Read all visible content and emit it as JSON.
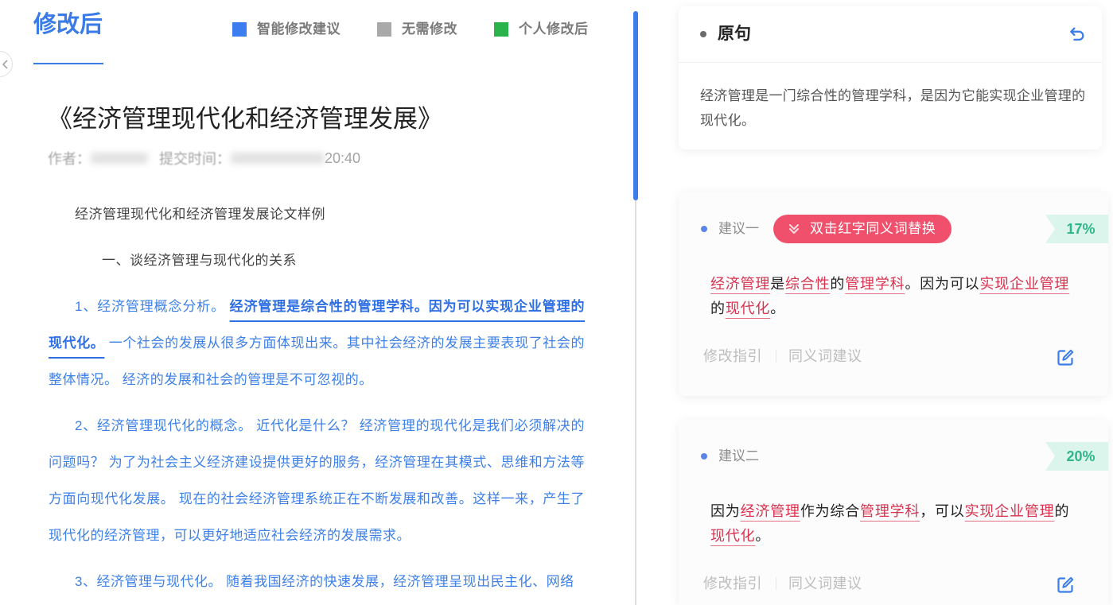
{
  "left_panel": {
    "tab_title": "修改后",
    "legend": [
      {
        "label": "智能修改建议",
        "color": "#3c7ef0"
      },
      {
        "label": "无需修改",
        "color": "#a9a9a9"
      },
      {
        "label": "个人修改后",
        "color": "#2bb34b"
      }
    ],
    "collapse_icon": "chevron-left-icon",
    "article": {
      "title": "《经济管理现代化和经济管理发展》",
      "meta": {
        "author_label": "作者：",
        "time_label": "提交时间：",
        "time_tail": "20:40"
      },
      "intro": "经济管理现代化和经济管理发展论文样例",
      "section_heading": "一、谈经济管理与现代化的关系",
      "paragraph_1": {
        "prefix": "1、经济管理概念分析。 ",
        "highlight": "经济管理是综合性的管理学科。因为可以实现企业管理的现代化。",
        "suffix": " 一个社会的发展从很多方面体现出来。其中社会经济的发展主要表现了社会的整体情况。 经济的发展和社会的管理是不可忽视的。"
      },
      "paragraph_2": "2、经济管理现代化的概念。 近代化是什么？ 经济管理的现代化是我们必须解决的问题吗？ 为了为社会主义经济建设提供更好的服务，经济管理在其模式、思维和方法等方面向现代化发展。 现在的社会经济管理系统正在不断发展和改善。这样一来，产生了现代化的经济管理，可以更好地适应社会经济的发展需求。",
      "paragraph_3": "3、经济管理与现代化。 随着我国经济的快速发展，经济管理呈现出民主化、网络"
    }
  },
  "right_panel": {
    "original": {
      "heading": "原句",
      "text": "经济管理是一门综合性的管理学科，是因为它能实现企业管理的现代化。",
      "action_icon": "undo-icon"
    },
    "suggestions": [
      {
        "label": "建议一",
        "hint_badge": "双击红字同义词替换",
        "hint_icon": "double-chevron-down-icon",
        "score": "17%",
        "body": [
          {
            "text": "经济管理",
            "synonym": true
          },
          {
            "text": "是",
            "synonym": false
          },
          {
            "text": "综合性",
            "synonym": true
          },
          {
            "text": "的",
            "synonym": false
          },
          {
            "text": "管理学科",
            "synonym": true
          },
          {
            "text": "。因为可以",
            "synonym": false
          },
          {
            "text": "实现企业管理",
            "synonym": true
          },
          {
            "text": "的",
            "synonym": false
          },
          {
            "text": "现代化",
            "synonym": true
          },
          {
            "text": "。",
            "synonym": false
          }
        ],
        "links": [
          "修改指引",
          "同义词建议"
        ],
        "edit_icon": "edit-icon"
      },
      {
        "label": "建议二",
        "score": "20%",
        "body": [
          {
            "text": "因为",
            "synonym": false
          },
          {
            "text": "经济管理",
            "synonym": true
          },
          {
            "text": "作为综合",
            "synonym": false
          },
          {
            "text": "管理学科",
            "synonym": true
          },
          {
            "text": "，可以",
            "synonym": false
          },
          {
            "text": "实现企业管理",
            "synonym": true
          },
          {
            "text": "的",
            "synonym": false
          },
          {
            "text": "现代化",
            "synonym": true
          },
          {
            "text": "。",
            "synonym": false
          }
        ],
        "links": [
          "修改指引",
          "同义词建议"
        ],
        "edit_icon": "edit-icon"
      }
    ]
  }
}
